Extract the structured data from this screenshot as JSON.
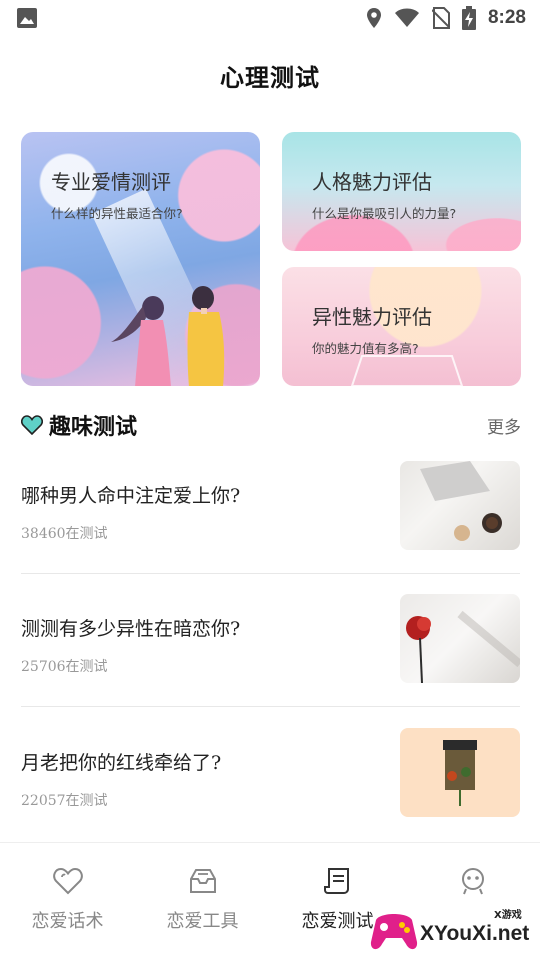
{
  "status_bar": {
    "time": "8:28",
    "icons": [
      "image-icon",
      "location-icon",
      "wifi-icon",
      "no-sim-icon",
      "battery-charging-icon"
    ]
  },
  "header": {
    "title": "心理测试"
  },
  "feature_cards": [
    {
      "title": "专业爱情测评",
      "subtitle": "什么样的异性最适合你?"
    },
    {
      "title": "人格魅力评估",
      "subtitle": "什么是你最吸引人的力量?"
    },
    {
      "title": "异性魅力评估",
      "subtitle": "你的魅力值有多高?"
    }
  ],
  "section": {
    "title": "趣味测试",
    "more": "更多",
    "icon": "heart-icon"
  },
  "quizzes": [
    {
      "title": "哪种男人命中注定爱上你?",
      "count": "38460在测试"
    },
    {
      "title": "测测有多少异性在暗恋你?",
      "count": "25706在测试"
    },
    {
      "title": "月老把你的红线牵给了?",
      "count": "22057在测试"
    }
  ],
  "bottom_nav": [
    {
      "label": "恋爱话术",
      "icon": "heart-outline-icon",
      "active": false
    },
    {
      "label": "恋爱工具",
      "icon": "inbox-tray-icon",
      "active": false
    },
    {
      "label": "恋爱测试",
      "icon": "document-scroll-icon",
      "active": true
    },
    {
      "label": "",
      "icon": "robot-icon",
      "active": false
    }
  ],
  "watermark": {
    "small": "X游戏",
    "text": "XYouXi.net"
  },
  "colors": {
    "accent_teal": "#5fd0c7",
    "text_dark": "#111111",
    "text_muted": "#999999"
  }
}
